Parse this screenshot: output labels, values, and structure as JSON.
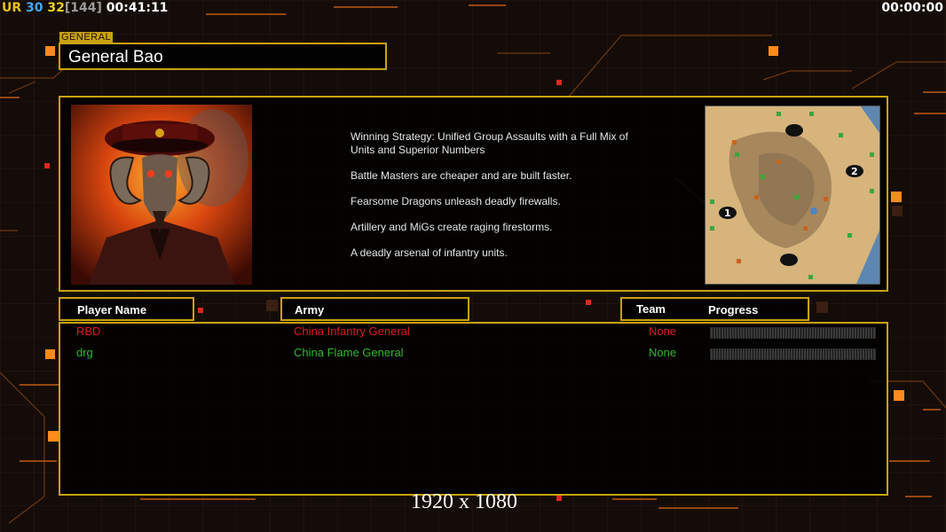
{
  "hud": {
    "ur_label": "UR",
    "val1": "30",
    "val2": "32",
    "bracket": "[144]",
    "time": "00:41:11",
    "timer_right": "00:00:00"
  },
  "general": {
    "tag": "GENERAL",
    "name": "General Bao",
    "strategy": [
      "Winning Strategy: Unified Group Assaults with a Full Mix of Units and Superior Numbers",
      "Battle Masters are cheaper and are built faster.",
      "Fearsome Dragons unleash deadly firewalls.",
      "Artillery and MiGs create raging firestorms.",
      "A deadly arsenal of infantry units."
    ]
  },
  "minimap": {
    "markers": [
      "1",
      "2"
    ]
  },
  "table": {
    "headers": {
      "player": "Player Name",
      "army": "Army",
      "team": "Team",
      "progress": "Progress"
    },
    "players": [
      {
        "name": "RBD",
        "army": "China Infantry General",
        "team": "None",
        "color": "#e01c1c",
        "progress": 0
      },
      {
        "name": "drg",
        "army": "China Flame General",
        "team": "None",
        "color": "#2eb82e",
        "progress": 0
      }
    ]
  },
  "resolution": "1920 x 1080",
  "colors": {
    "accent": "#c9a20f",
    "orange": "#ff8a1e"
  }
}
